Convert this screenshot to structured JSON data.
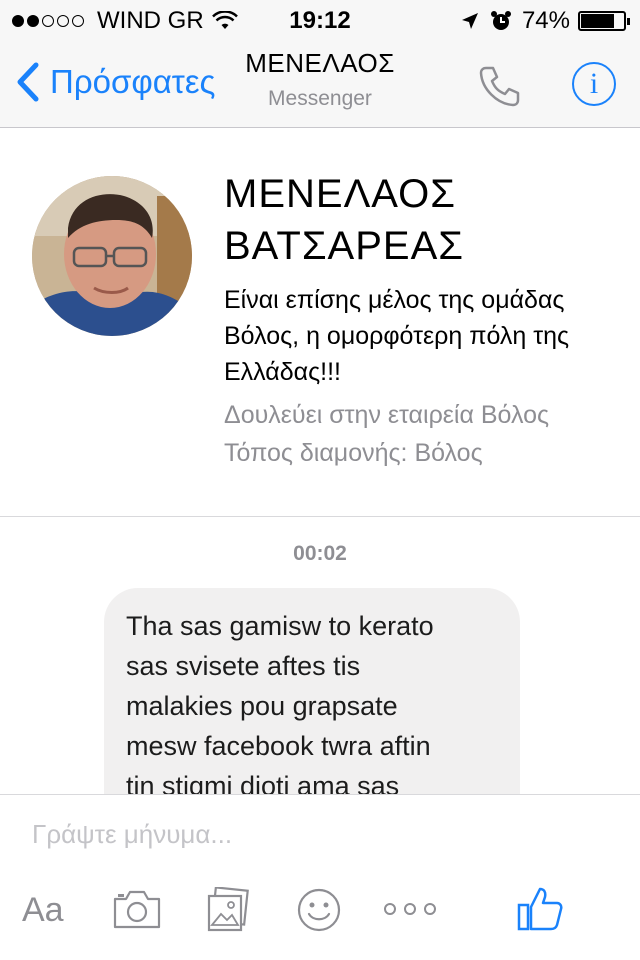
{
  "status_bar": {
    "carrier": "WIND GR",
    "time": "19:12",
    "battery": "74%",
    "signal_bars_full": 2,
    "signal_bars_total": 5
  },
  "nav": {
    "back_label": "Πρόσφατες",
    "title": "ΜΕΝΕΛΑΟΣ",
    "subtitle": "Messenger",
    "accent_color": "#1a82fb"
  },
  "profile": {
    "name_line1": "ΜΕΝΕΛΑΟΣ",
    "name_line2": "ΒΑΤΣΑΡΕΑΣ",
    "bio": "Είναι επίσης μέλος της ομάδας Βόλος, η ομορφότερη πόλη της Ελλάδας!!!",
    "work": "Δουλεύει στην εταιρεία Βόλος",
    "residence": "Τόπος διαμονής: Βόλος"
  },
  "conversation": {
    "timestamp": "00:02",
    "message": "Tha sas gamisw to kerato\nsas svisete aftes tis\nmalakies pou grapsate\nmesw facebook twra aftin\ntin stigmi dioti ama sas"
  },
  "composer": {
    "placeholder": "Γράψτε μήνυμα...",
    "text_format_label": "Aa",
    "icons": [
      "text-format-icon",
      "camera-icon",
      "photo-gallery-icon",
      "emoji-icon",
      "more-icon",
      "like-icon"
    ]
  }
}
